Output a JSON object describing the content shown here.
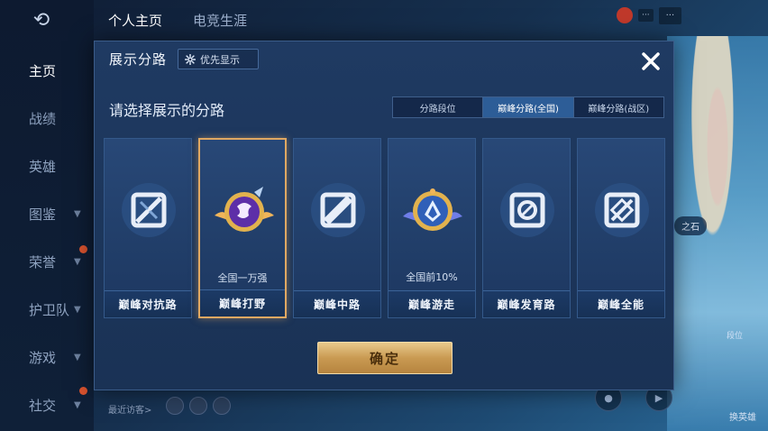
{
  "background": {
    "tabs": [
      "个人主页",
      "电竞生涯"
    ],
    "sidebar": [
      {
        "label": "主页",
        "active": true,
        "chevron": false
      },
      {
        "label": "战绩",
        "active": false,
        "chevron": false
      },
      {
        "label": "英雄",
        "active": false,
        "chevron": false
      },
      {
        "label": "图鉴",
        "active": false,
        "chevron": true
      },
      {
        "label": "荣誉",
        "active": false,
        "chevron": true
      },
      {
        "label": "护卫队",
        "active": false,
        "chevron": true
      },
      {
        "label": "游戏",
        "active": false,
        "chevron": true
      },
      {
        "label": "社交",
        "active": false,
        "chevron": true
      }
    ],
    "hero_tag": "之石",
    "bottom_text": "最近访客>",
    "switch_label": "换英雄",
    "rank_label": "段位"
  },
  "modal": {
    "title": "展示分路",
    "priority_label": "优先显示",
    "subtitle": "请选择展示的分路",
    "segments": [
      {
        "label": "分路段位",
        "active": false
      },
      {
        "label": "巅峰分路(全国)",
        "active": true
      },
      {
        "label": "巅峰分路(战区)",
        "active": false
      }
    ],
    "cards": [
      {
        "label": "巅峰对抗路",
        "rank": "",
        "emblem": "clash-lane-emblem-icon",
        "selected": false
      },
      {
        "label": "巅峰打野",
        "rank": "全国一万强",
        "emblem": "jungle-rank-badge-icon",
        "selected": true
      },
      {
        "label": "巅峰中路",
        "rank": "",
        "emblem": "mid-lane-emblem-icon",
        "selected": false
      },
      {
        "label": "巅峰游走",
        "rank": "全国前10%",
        "emblem": "roam-rank-badge-icon",
        "selected": false
      },
      {
        "label": "巅峰发育路",
        "rank": "",
        "emblem": "farm-lane-emblem-icon",
        "selected": false
      },
      {
        "label": "巅峰全能",
        "rank": "",
        "emblem": "all-round-emblem-icon",
        "selected": false
      }
    ],
    "confirm_label": "确定"
  },
  "colors": {
    "accent_gold": "#e0a862",
    "active_segment": "#2d5d97",
    "modal_bg": "#1f3a62"
  }
}
